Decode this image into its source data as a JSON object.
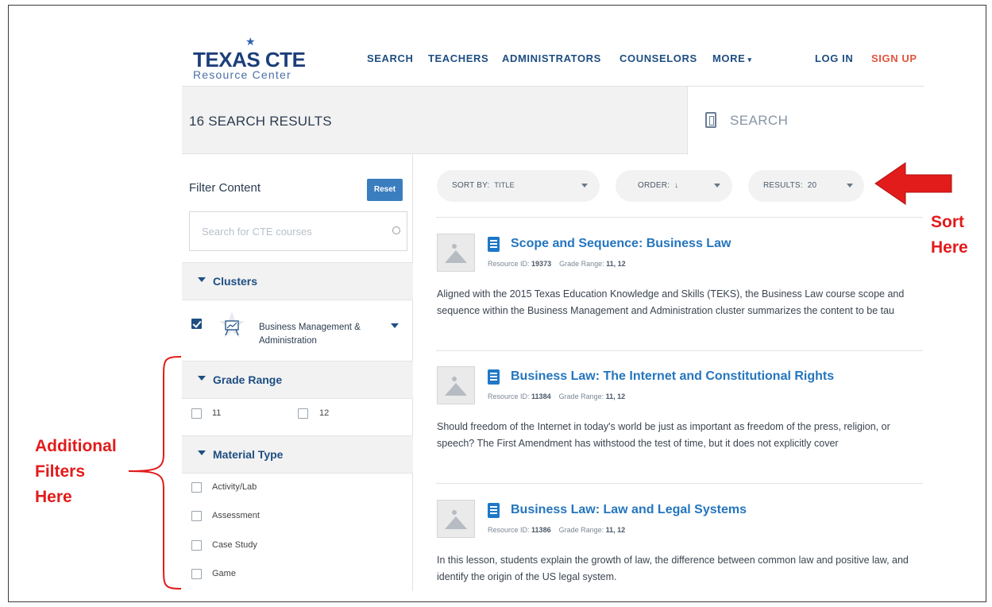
{
  "logo": {
    "main": "TEXAS CTE",
    "sub": "Resource Center"
  },
  "nav": {
    "items": [
      "SEARCH",
      "TEACHERS",
      "ADMINISTRATORS",
      "COUNSELORS",
      "MORE"
    ],
    "login": "LOG IN",
    "signup": "SIGN UP"
  },
  "results_band": {
    "title": "16 SEARCH RESULTS",
    "search_label": "SEARCH"
  },
  "sidebar": {
    "filter_title": "Filter Content",
    "reset_label": "Reset",
    "course_search_placeholder": "Search for CTE courses",
    "clusters": {
      "heading": "Clusters",
      "items": [
        {
          "label": "Business Management & Administration",
          "checked": true
        }
      ]
    },
    "grade_range": {
      "heading": "Grade Range",
      "options": [
        {
          "label": "11",
          "checked": false
        },
        {
          "label": "12",
          "checked": false
        }
      ]
    },
    "material_type": {
      "heading": "Material Type",
      "options": [
        {
          "label": "Activity/Lab",
          "checked": false
        },
        {
          "label": "Assessment",
          "checked": false
        },
        {
          "label": "Case Study",
          "checked": false
        },
        {
          "label": "Game",
          "checked": false
        }
      ]
    }
  },
  "sort": {
    "sort_by_label": "SORT BY:",
    "sort_by_value": "TITLE",
    "order_label": "ORDER:",
    "order_value": "↓",
    "results_label": "RESULTS:",
    "results_value": "20"
  },
  "results": [
    {
      "title": "Scope and Sequence: Business Law",
      "resource_id_label": "Resource ID:",
      "resource_id": "19373",
      "grade_label": "Grade Range:",
      "grade": "11, 12",
      "description": "Aligned with the 2015 Texas Education Knowledge and Skills (TEKS), the Business Law course scope and sequence within the Business Management and Administration cluster summarizes the content to be tau"
    },
    {
      "title": "Business Law: The Internet and Constitutional Rights",
      "resource_id_label": "Resource ID:",
      "resource_id": "11384",
      "grade_label": "Grade Range:",
      "grade": "11, 12",
      "description": "Should freedom of the Internet in today's world be just as important as freedom of the press, religion, or speech? The First Amendment has withstood the test of time, but it does not explicitly cover"
    },
    {
      "title": "Business Law: Law and Legal Systems",
      "resource_id_label": "Resource ID:",
      "resource_id": "11386",
      "grade_label": "Grade Range:",
      "grade": "11, 12",
      "description": "In this lesson, students explain the growth of law, the difference between common law and positive law, and identify the origin of the US legal system."
    }
  ],
  "annotations": {
    "sort_line1": "Sort",
    "sort_line2": "Here",
    "filters_line1": "Additional",
    "filters_line2": "Filters",
    "filters_line3": "Here"
  },
  "colors": {
    "brand_navy": "#1e4e82",
    "link_blue": "#2475be",
    "signup_orange": "#e2543c",
    "annotation_red": "#e21b1b",
    "reset_blue": "#3a7ebf"
  }
}
